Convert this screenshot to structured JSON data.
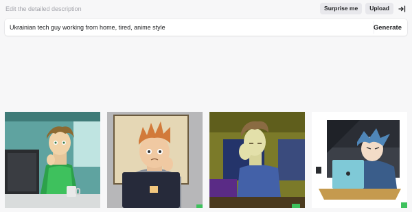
{
  "header": {
    "hint": "Edit the detailed description",
    "surprise_label": "Surprise me",
    "upload_label": "Upload",
    "collapse_icon": "collapse-right-icon"
  },
  "prompt": {
    "value": "Ukrainian tech guy working from home, tired, anime style",
    "generate_label": "Generate"
  },
  "results": [
    {
      "name": "result-image-1"
    },
    {
      "name": "result-image-2"
    },
    {
      "name": "result-image-3"
    },
    {
      "name": "result-image-4"
    }
  ],
  "colors": {
    "background": "#f7f7f8",
    "pill": "#e8e8ec",
    "text": "#202123",
    "hint": "#a2a3aa"
  }
}
